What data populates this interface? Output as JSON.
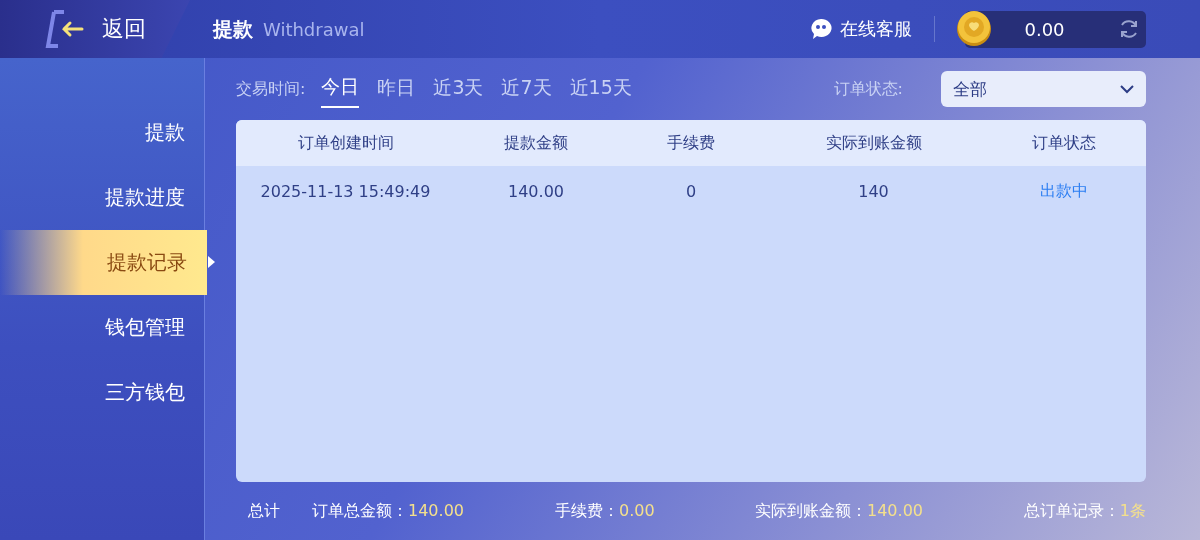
{
  "header": {
    "back_label": "返回",
    "title": "提款",
    "subtitle": "Withdrawal",
    "support_label": "在线客服",
    "balance": "0.00"
  },
  "sidebar": {
    "items": [
      {
        "label": "提款",
        "selected": false
      },
      {
        "label": "提款进度",
        "selected": false
      },
      {
        "label": "提款记录",
        "selected": true
      },
      {
        "label": "钱包管理",
        "selected": false
      },
      {
        "label": "三方钱包",
        "selected": false
      }
    ]
  },
  "filters": {
    "time_label": "交易时间:",
    "time_tabs": [
      {
        "label": "今日",
        "selected": true
      },
      {
        "label": "昨日",
        "selected": false
      },
      {
        "label": "近3天",
        "selected": false
      },
      {
        "label": "近7天",
        "selected": false
      },
      {
        "label": "近15天",
        "selected": false
      }
    ],
    "status_label": "订单状态:",
    "status_value": "全部"
  },
  "table": {
    "columns": [
      {
        "label": "订单创建时间",
        "kind": "text"
      },
      {
        "label": "提款金额",
        "kind": "text"
      },
      {
        "label": "手续费",
        "kind": "text"
      },
      {
        "label": "实际到账金额",
        "kind": "text"
      },
      {
        "label": "订单状态",
        "kind": "status"
      }
    ],
    "rows": [
      {
        "cells": [
          "2025-11-13 15:49:49",
          "140.00",
          "0",
          "140",
          "出款中"
        ]
      }
    ]
  },
  "summary": {
    "label": "总计",
    "items": [
      {
        "label": "订单总金额：",
        "value": "140.00"
      },
      {
        "label": "手续费：",
        "value": "0.00"
      },
      {
        "label": "实际到账金额：",
        "value": "140.00"
      },
      {
        "label": "总订单记录：",
        "value": "1条"
      }
    ]
  }
}
